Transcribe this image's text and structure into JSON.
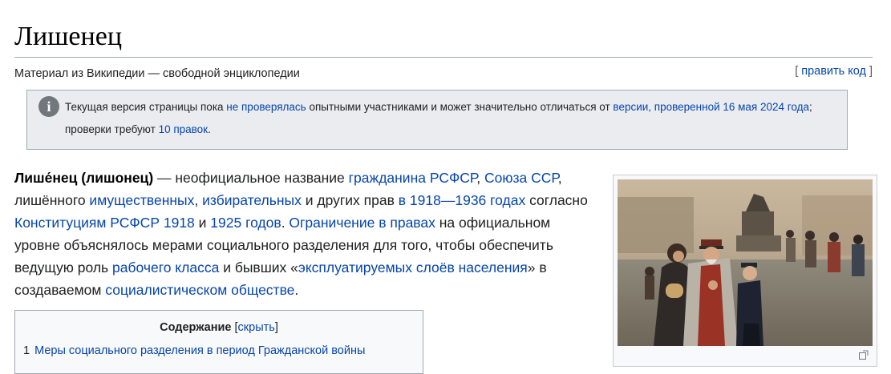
{
  "page": {
    "title": "Лишенец",
    "site_sub": "Материал из Википедии — свободной энциклопедии"
  },
  "edit": {
    "bracket_open": "[",
    "label": "править код",
    "bracket_close": "]"
  },
  "notice": {
    "icon": "info-icon",
    "icon_glyph": "i",
    "t1": "Текущая версия страницы пока ",
    "l1": "не проверялась",
    "t2": " опытными участниками и может значительно отличаться от ",
    "l2": "версии, проверенной 16 мая 2024 года",
    "t3": "; проверки требуют ",
    "l3": "10 правок",
    "t4": "."
  },
  "lead": {
    "bold": "Лише́нец (лишонец)",
    "t1": " — неофициальное название ",
    "l1": "гражданина РСФСР",
    "t2": ", ",
    "l2": "Союза ССР",
    "t3": ", лишённого ",
    "l3": "имущественных",
    "t4": ", ",
    "l4": "избирательных",
    "t5": " и других прав ",
    "l5": "в 1918—1936 годах",
    "t6": " согласно ",
    "l6": "Конституциям РСФСР 1918",
    "t7": " и ",
    "l7": "1925 годов",
    "t8": ". ",
    "l8": "Ограничение в правах",
    "t9": " на официальном уровне объяснялось мерами социального разделения для того, чтобы обеспечить ведущую роль ",
    "l9": "рабочего класса",
    "t10": " и бывших «",
    "l10": "эксплуатируемых слоёв населения",
    "t11": "» в создаваемом ",
    "l11": "социалистическом обществе",
    "t12": "."
  },
  "toc": {
    "title": "Содержание",
    "bracket_open": " [",
    "toggle": "скрыть",
    "bracket_close": "]",
    "items": [
      {
        "num": "1",
        "label": "Меры социального разделения в период Гражданской войны"
      }
    ]
  },
  "infobox": {
    "image_alt": "painting-of-people-on-street",
    "enlarge_icon": "enlarge-icon"
  }
}
